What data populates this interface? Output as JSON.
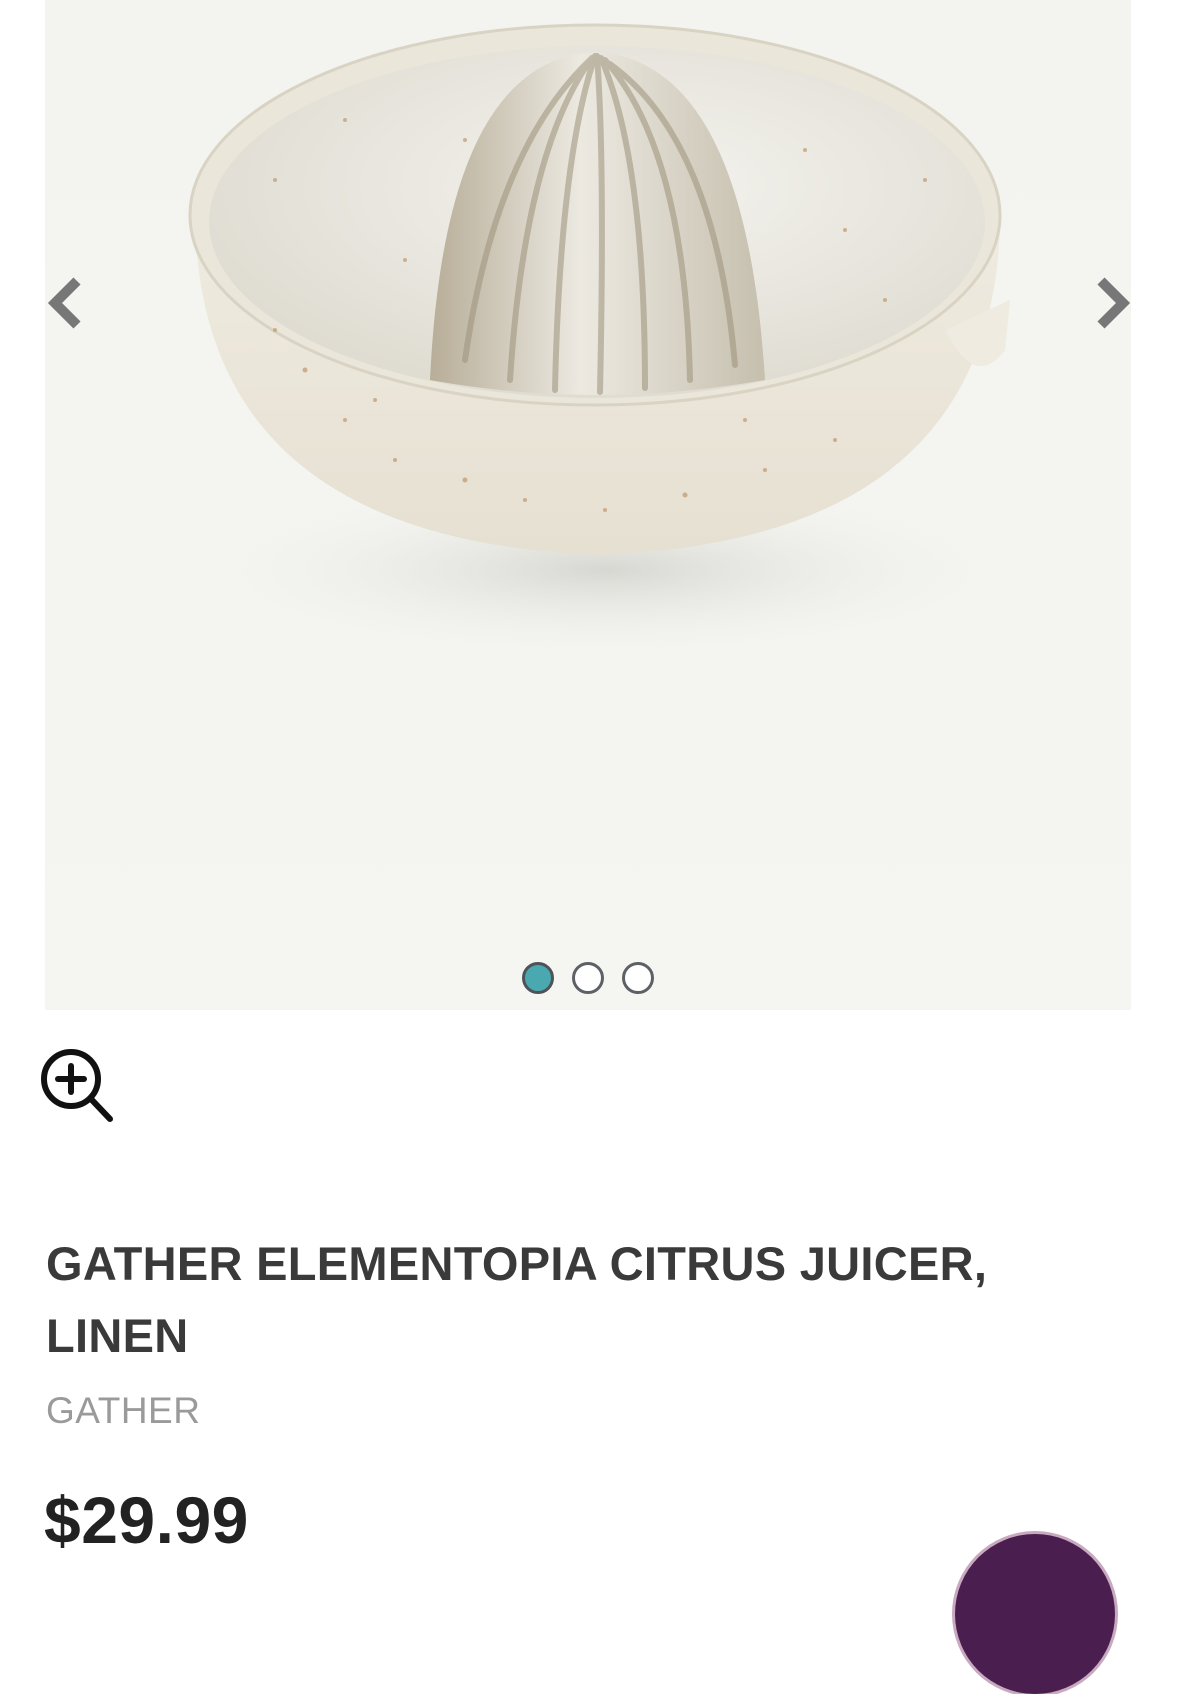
{
  "product": {
    "title": "GATHER ELEMENTOPIA CITRUS JUICER, LINEN",
    "brand": "GATHER",
    "price": "$29.99"
  },
  "gallery": {
    "image_count": 3,
    "active_index": 0,
    "accent_color": "#4aa9b0",
    "icons": [
      "chevron-left-icon",
      "chevron-right-icon",
      "zoom-in-icon"
    ]
  }
}
